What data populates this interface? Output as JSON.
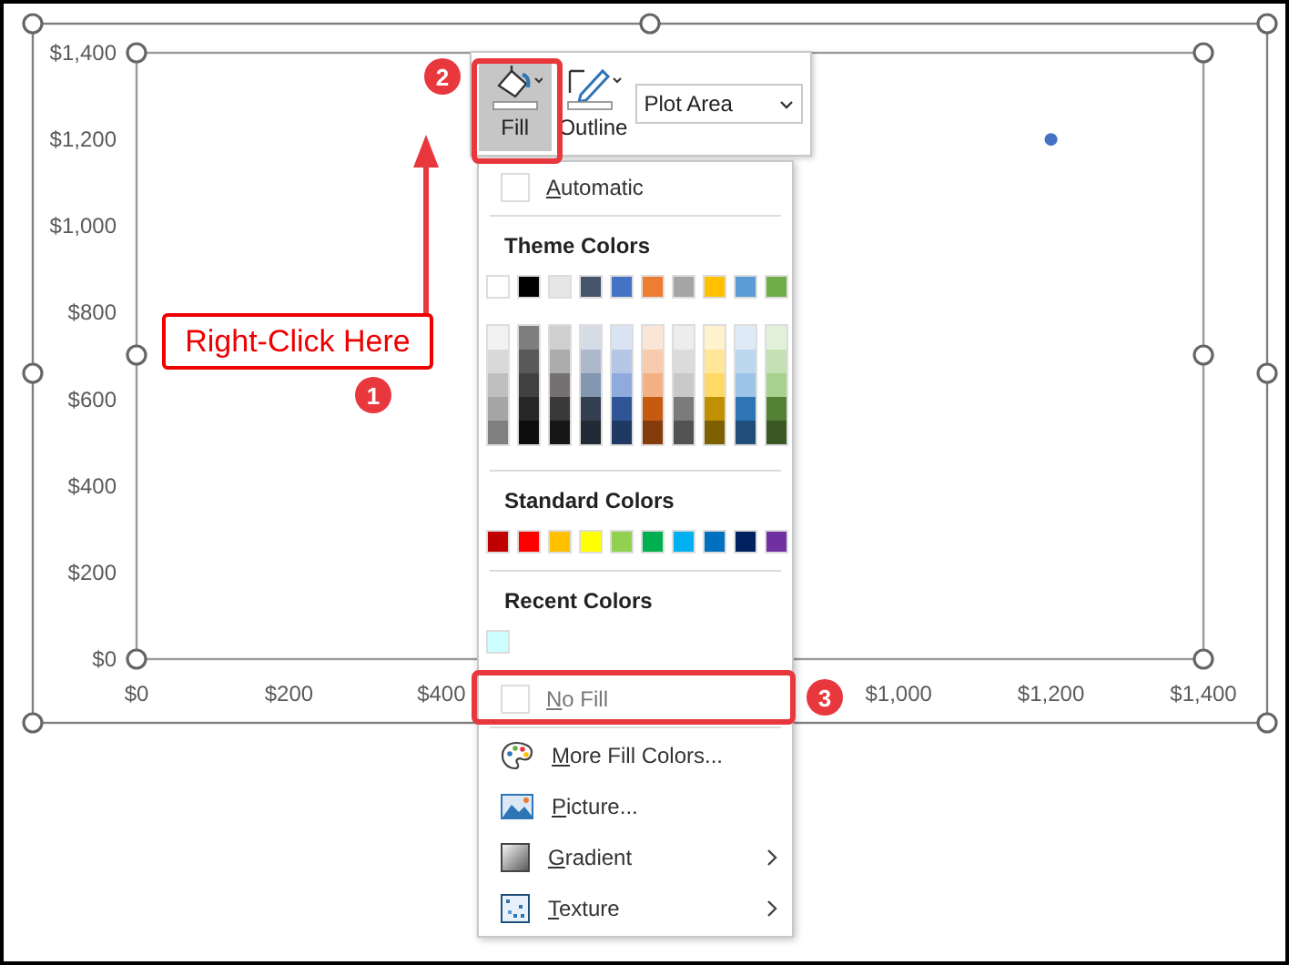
{
  "chart": {
    "chart_data": {
      "type": "scatter",
      "x": [
        1200
      ],
      "series": [
        {
          "color": "#4472c4",
          "values": [
            1200
          ]
        }
      ],
      "xlim": [
        0,
        1400
      ],
      "ylim": [
        0,
        1400
      ],
      "xticks": [
        {
          "value": 0,
          "label": "$0"
        },
        {
          "value": 200,
          "label": "$200"
        },
        {
          "value": 400,
          "label": "$400"
        },
        {
          "value": 1000,
          "label": "$1,000"
        },
        {
          "value": 1200,
          "label": "$1,200"
        },
        {
          "value": 1400,
          "label": "$1,400"
        }
      ],
      "yticks": [
        {
          "value": 0,
          "label": "$0"
        },
        {
          "value": 200,
          "label": "$200"
        },
        {
          "value": 400,
          "label": "$400"
        },
        {
          "value": 600,
          "label": "$600"
        },
        {
          "value": 800,
          "label": "$800"
        },
        {
          "value": 1000,
          "label": "$1,000"
        },
        {
          "value": 1200,
          "label": "$1,200"
        },
        {
          "value": 1400,
          "label": "$1,400"
        }
      ]
    }
  },
  "format_toolbar": {
    "buttons": [
      {
        "label": "Fill",
        "kind": "fill",
        "selected": true
      },
      {
        "label": "Outline",
        "kind": "outline",
        "selected": false
      }
    ],
    "element_dropdown": {
      "value": "Plot Area"
    }
  },
  "fill_menu": {
    "automatic": "Automatic",
    "sections": [
      {
        "title": "Theme Colors",
        "colors": [
          {
            "color": "#ffffff"
          },
          {
            "color": "#000000"
          },
          {
            "color": "#e7e6e6"
          },
          {
            "color": "#44546a"
          },
          {
            "color": "#4472c4"
          },
          {
            "color": "#ed7d31"
          },
          {
            "color": "#a5a5a5"
          },
          {
            "color": "#ffc000"
          },
          {
            "color": "#5b9bd5"
          },
          {
            "color": "#70ad47"
          }
        ],
        "shades": [
          [
            {
              "color": "#f2f2f2"
            },
            {
              "color": "#d9d9d9"
            },
            {
              "color": "#bfbfbf"
            },
            {
              "color": "#a6a6a6"
            },
            {
              "color": "#808080"
            }
          ],
          [
            {
              "color": "#7f7f7f"
            },
            {
              "color": "#595959"
            },
            {
              "color": "#404040"
            },
            {
              "color": "#262626"
            },
            {
              "color": "#0d0d0d"
            }
          ],
          [
            {
              "color": "#d0cece"
            },
            {
              "color": "#aeabab"
            },
            {
              "color": "#757171"
            },
            {
              "color": "#3a3838"
            },
            {
              "color": "#171616"
            }
          ],
          [
            {
              "color": "#d6dce5"
            },
            {
              "color": "#adb9ca"
            },
            {
              "color": "#8497b0"
            },
            {
              "color": "#333f50"
            },
            {
              "color": "#222a35"
            }
          ],
          [
            {
              "color": "#dae3f3"
            },
            {
              "color": "#b4c7e7"
            },
            {
              "color": "#8faadc"
            },
            {
              "color": "#2f5597"
            },
            {
              "color": "#203864"
            }
          ],
          [
            {
              "color": "#fbe5d6"
            },
            {
              "color": "#f8cbad"
            },
            {
              "color": "#f4b183"
            },
            {
              "color": "#c55a11"
            },
            {
              "color": "#843c0c"
            }
          ],
          [
            {
              "color": "#ededed"
            },
            {
              "color": "#dbdbdb"
            },
            {
              "color": "#c9c9c9"
            },
            {
              "color": "#7b7b7b"
            },
            {
              "color": "#525252"
            }
          ],
          [
            {
              "color": "#fff2cc"
            },
            {
              "color": "#ffe699"
            },
            {
              "color": "#ffd966"
            },
            {
              "color": "#bf9000"
            },
            {
              "color": "#7f6000"
            }
          ],
          [
            {
              "color": "#deebf7"
            },
            {
              "color": "#bdd7ee"
            },
            {
              "color": "#9dc3e6"
            },
            {
              "color": "#2e75b6"
            },
            {
              "color": "#1f4e79"
            }
          ],
          [
            {
              "color": "#e2f0d9"
            },
            {
              "color": "#c5e0b4"
            },
            {
              "color": "#a9d18e"
            },
            {
              "color": "#548235"
            },
            {
              "color": "#385723"
            }
          ]
        ]
      },
      {
        "title": "Standard Colors",
        "colors": [
          {
            "color": "#c00000"
          },
          {
            "color": "#ff0000"
          },
          {
            "color": "#ffc000"
          },
          {
            "color": "#ffff00"
          },
          {
            "color": "#92d050"
          },
          {
            "color": "#00b050"
          },
          {
            "color": "#00b0f0"
          },
          {
            "color": "#0070c0"
          },
          {
            "color": "#002060"
          },
          {
            "color": "#7030a0"
          }
        ]
      },
      {
        "title": "Recent Colors",
        "colors": [
          {
            "color": "#ccffff"
          }
        ]
      }
    ],
    "no_fill": "No Fill",
    "items": [
      {
        "label": "More Fill Colors...",
        "kind": "palette",
        "submenu": false
      },
      {
        "label": "Picture...",
        "kind": "picture",
        "submenu": false
      },
      {
        "label": "Gradient",
        "kind": "gradient",
        "submenu": true
      },
      {
        "label": "Texture",
        "kind": "texture",
        "submenu": true
      }
    ]
  },
  "callouts": {
    "label": "Right-Click Here",
    "steps": [
      "1",
      "2",
      "3"
    ]
  }
}
